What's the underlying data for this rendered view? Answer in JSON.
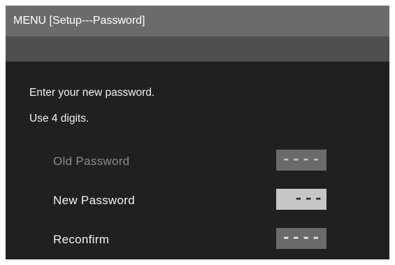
{
  "menu": {
    "title": "MENU [Setup---Password]"
  },
  "instructions": {
    "line1": "Enter your new password.",
    "line2": "Use 4 digits."
  },
  "fields": {
    "old_password": {
      "label": "Old Password",
      "value": "----",
      "state": "disabled"
    },
    "new_password": {
      "label": "New Password",
      "value": "---",
      "state": "selected"
    },
    "reconfirm": {
      "label": "Reconfirm",
      "value": "----",
      "state": "normal"
    }
  },
  "colors": {
    "title_bar": "#6b6b6d",
    "sub_bar": "#4f4f51",
    "background": "#221f1f",
    "text": "#f2f2f2",
    "disabled_text": "#8a8a8a",
    "selected_field": "#c6c6c6",
    "field": "#6a6a6c"
  }
}
